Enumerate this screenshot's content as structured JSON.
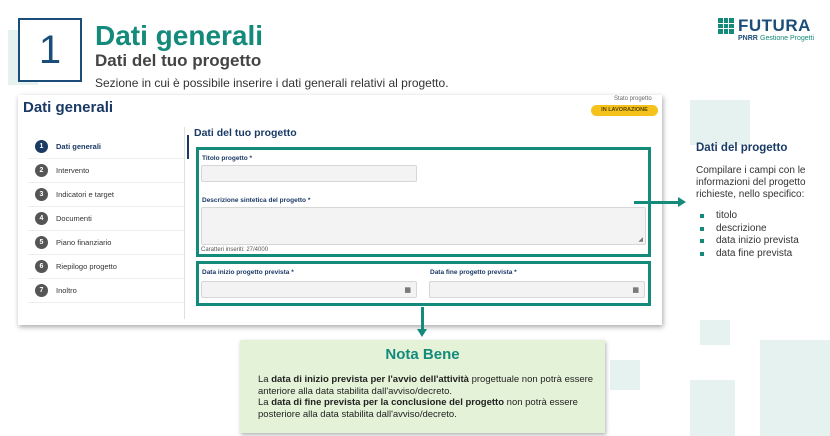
{
  "header": {
    "step_number": "1",
    "title": "Dati generali",
    "subtitle": "Dati del tuo progetto",
    "description": "Sezione in cui è possibile inserire i dati generali relativi al progetto."
  },
  "logo": {
    "word": "FUTURA",
    "sub1": "PNRR",
    "sub2": "Gestione Progetti"
  },
  "card": {
    "title": "Dati generali",
    "stato_label": "Stato progetto",
    "stato_value": "IN LAVORAZIONE",
    "sidebar": [
      {
        "num": "1",
        "label": "Dati generali"
      },
      {
        "num": "2",
        "label": "Intervento"
      },
      {
        "num": "3",
        "label": "Indicatori e target"
      },
      {
        "num": "4",
        "label": "Documenti"
      },
      {
        "num": "5",
        "label": "Piano finanziario"
      },
      {
        "num": "6",
        "label": "Riepilogo progetto"
      },
      {
        "num": "7",
        "label": "Inoltro"
      }
    ],
    "form": {
      "title": "Dati del tuo progetto",
      "titolo_label": "Titolo progetto *",
      "descrizione_label": "Descrizione sintetica del progetto *",
      "char_counter": "Caratteri inseriti: 27/4000",
      "data_inizio_label": "Data inizio progetto prevista *",
      "data_fine_label": "Data fine progetto prevista *"
    }
  },
  "right_panel": {
    "title": "Dati del progetto",
    "text": "Compilare i campi con le informazioni del progetto richieste, nello specifico:",
    "items": [
      "titolo",
      "descrizione",
      "data inizio prevista",
      "data fine prevista"
    ]
  },
  "nota": {
    "title": "Nota Bene",
    "p1_pre": "La ",
    "p1_bold": "data di inizio prevista per l'avvio dell'attività",
    "p1_post": " progettuale non potrà essere anteriore alla data stabilita dall'avviso/decreto.",
    "p2_pre": "La ",
    "p2_bold": "data di fine prevista per la conclusione del progetto",
    "p2_post": " non potrà essere posteriore alla data stabilita dall'avviso/decreto."
  },
  "colors": {
    "teal": "#148a7a",
    "navy": "#1a3a66",
    "badge": "#f5c21c",
    "note_bg": "#e4f2d8"
  }
}
